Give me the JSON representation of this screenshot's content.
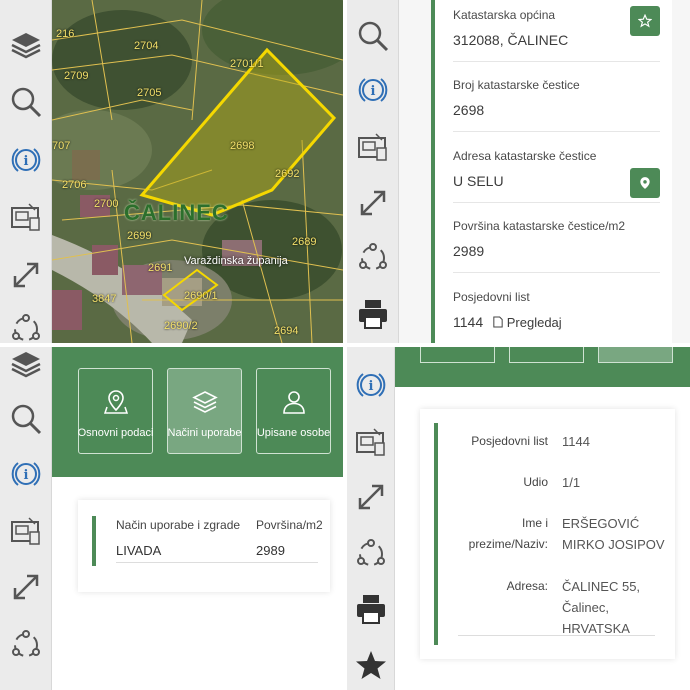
{
  "toolbar": {
    "icons": [
      "layers-icon",
      "search-icon",
      "info-icon",
      "parcel-documents-icon",
      "expand-icon",
      "share-icon",
      "print-icon",
      "star-icon"
    ]
  },
  "map": {
    "parcel_labels": [
      "2704",
      "2701/1",
      "216",
      "2709",
      "2705",
      "2698",
      "707",
      "2706",
      "2700",
      "2692",
      "2699",
      "2689",
      "2691",
      "2690/1",
      "3847",
      "2690/2",
      "2694"
    ],
    "place_name": "ČALINEC",
    "region_name": "Varaždinska županija",
    "highlight_color": "#f5d800"
  },
  "parcel": {
    "municipality_label": "Katastarska općina",
    "municipality_value": "312088, ČALINEC",
    "number_label": "Broj katastarske čestice",
    "number_value": "2698",
    "address_label": "Adresa katastarske čestice",
    "address_value": "U SELU",
    "area_label": "Površina katastarske čestice/m2",
    "area_value": "2989",
    "holding_label": "Posjedovni list",
    "holding_value": "1144",
    "view_link": "Pregledaj"
  },
  "tabs": [
    {
      "label": "Osnovni podaci",
      "icon": "map-pin-icon"
    },
    {
      "label": "Načini uporabe",
      "icon": "layers-icon"
    },
    {
      "label": "Upisane osobe",
      "icon": "person-icon"
    }
  ],
  "usage": {
    "col_type": "Način uporabe i zgrade",
    "col_area": "Površina/m2",
    "type_value": "LIVADA",
    "area_value": "2989"
  },
  "owner": {
    "holding_label": "Posjedovni list",
    "holding_value": "1144",
    "share_label": "Udio",
    "share_value": "1/1",
    "name_label": "Ime i prezime/Naziv:",
    "name_value": "ERŠEGOVIĆ MIRKO JOSIPOV",
    "address_label": "Adresa:",
    "address_value": "ČALINEC 55, Čalinec, HRVATSKA"
  },
  "colors": {
    "accent": "#4d8a57",
    "toolbar_bg": "#ebebeb",
    "info_blue": "#2f6fb6"
  }
}
